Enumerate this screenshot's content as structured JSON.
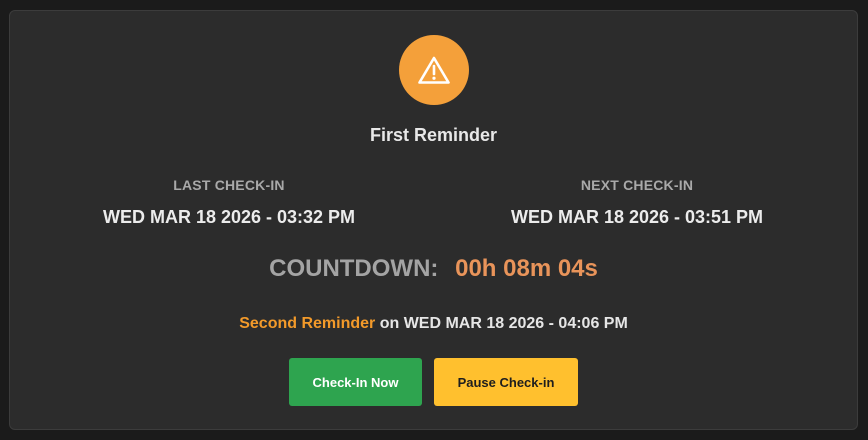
{
  "status": {
    "icon": "warning-triangle-icon",
    "title": "First Reminder",
    "accent_color": "#f4a03a"
  },
  "last_checkin": {
    "label": "LAST CHECK-IN",
    "value": "WED MAR 18 2026 - 03:32 PM"
  },
  "next_checkin": {
    "label": "NEXT CHECK-IN",
    "value": "WED MAR 18 2026 - 03:51 PM"
  },
  "countdown": {
    "label": "COUNTDOWN:",
    "value": "00h 08m 04s",
    "value_color": "#e9945a"
  },
  "next_reminder": {
    "name": "Second Reminder",
    "connector": "on",
    "datetime": "WED MAR 18 2026 - 04:06 PM"
  },
  "actions": {
    "checkin_label": "Check-In Now",
    "checkin_color": "#2ea44f",
    "pause_label": "Pause Check-in",
    "pause_color": "#ffc02e"
  }
}
